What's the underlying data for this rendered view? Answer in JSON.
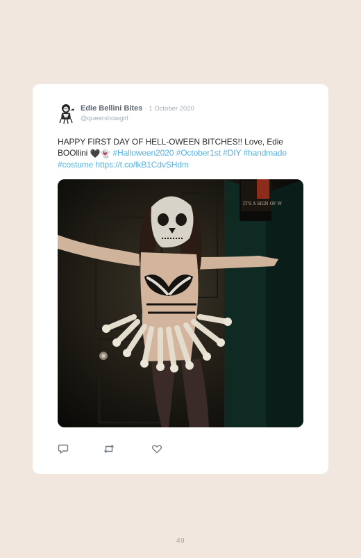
{
  "tweet": {
    "display_name": "Edie Bellini Bites",
    "separator": "·",
    "date": "1 October 2020",
    "handle": "@queershowgirl",
    "text_plain": "HAPPY FIRST DAY OF HELL-OWEEN BITCHES!! Love, Edie BOOllini",
    "emoji_heart": "🖤",
    "emoji_ghost": "👻",
    "hashtags": [
      "#Halloween2020",
      "#October1st",
      "#DIY",
      "#handmade",
      "#costume"
    ],
    "link": "https://t.co/lkB1CdvSHdm",
    "photo_sign_text": "IT'S A SIGN OF W"
  },
  "actions": {
    "reply_icon": "reply-icon",
    "retweet_icon": "retweet-icon",
    "like_icon": "heart-icon"
  },
  "colors": {
    "page_background": "#f1e7df",
    "card": "#ffffff",
    "link": "#55b2e4",
    "name": "#5d6770",
    "muted": "#a5aeb6"
  },
  "page_number": "49"
}
